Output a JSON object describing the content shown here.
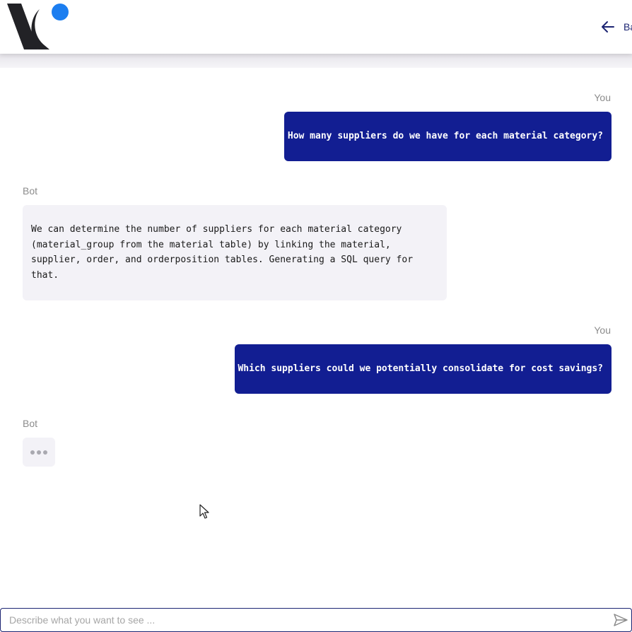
{
  "header": {
    "back_label": "Back"
  },
  "messages": [
    {
      "sender": "You",
      "text": "How many suppliers do we have for each material category?"
    },
    {
      "sender": "Bot",
      "text": "We can determine the number of suppliers for each material category (material_group from the material table) by linking the material, supplier, order, and orderposition tables. Generating a SQL query for that."
    },
    {
      "sender": "You",
      "text": "Which suppliers could we potentially consolidate for cost savings?"
    },
    {
      "sender": "Bot",
      "typing": true
    }
  ],
  "composer": {
    "placeholder": "Describe what you want to see ...",
    "value": "",
    "send_icon": "send-icon"
  },
  "colors": {
    "user_bubble": "#121e92",
    "bot_bubble": "#f3f2f7",
    "logo_dark": "#222226",
    "logo_accent": "#1c7ef0",
    "nav_text": "#1c2472"
  },
  "icons": {
    "logo": "logo-icon",
    "back": "arrow-left-icon",
    "typing": "typing-dots-icon",
    "cursor": "mouse-cursor-icon"
  }
}
